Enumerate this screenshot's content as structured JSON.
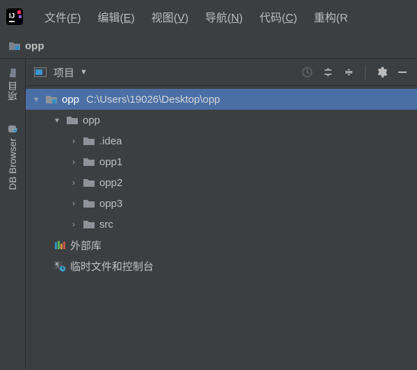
{
  "menu": {
    "items": [
      {
        "label": "文件",
        "mnemonic": "F"
      },
      {
        "label": "编辑",
        "mnemonic": "E"
      },
      {
        "label": "视图",
        "mnemonic": "V"
      },
      {
        "label": "导航",
        "mnemonic": "N"
      },
      {
        "label": "代码",
        "mnemonic": "C"
      },
      {
        "label": "重构",
        "mnemonic": "R"
      }
    ]
  },
  "breadcrumb": {
    "project": "opp"
  },
  "rail": {
    "project": "项目",
    "dbbrowser": "DB Browser"
  },
  "panel": {
    "title": "项目"
  },
  "tree": {
    "root": {
      "name": "opp",
      "path": "C:\\Users\\19026\\Desktop\\opp"
    },
    "children": [
      {
        "name": "opp",
        "expanded": true,
        "children": [
          {
            "name": ".idea"
          },
          {
            "name": "opp1"
          },
          {
            "name": "opp2"
          },
          {
            "name": "opp3"
          },
          {
            "name": "src"
          }
        ]
      }
    ],
    "external_libs": "外部库",
    "scratches": "临时文件和控制台"
  }
}
